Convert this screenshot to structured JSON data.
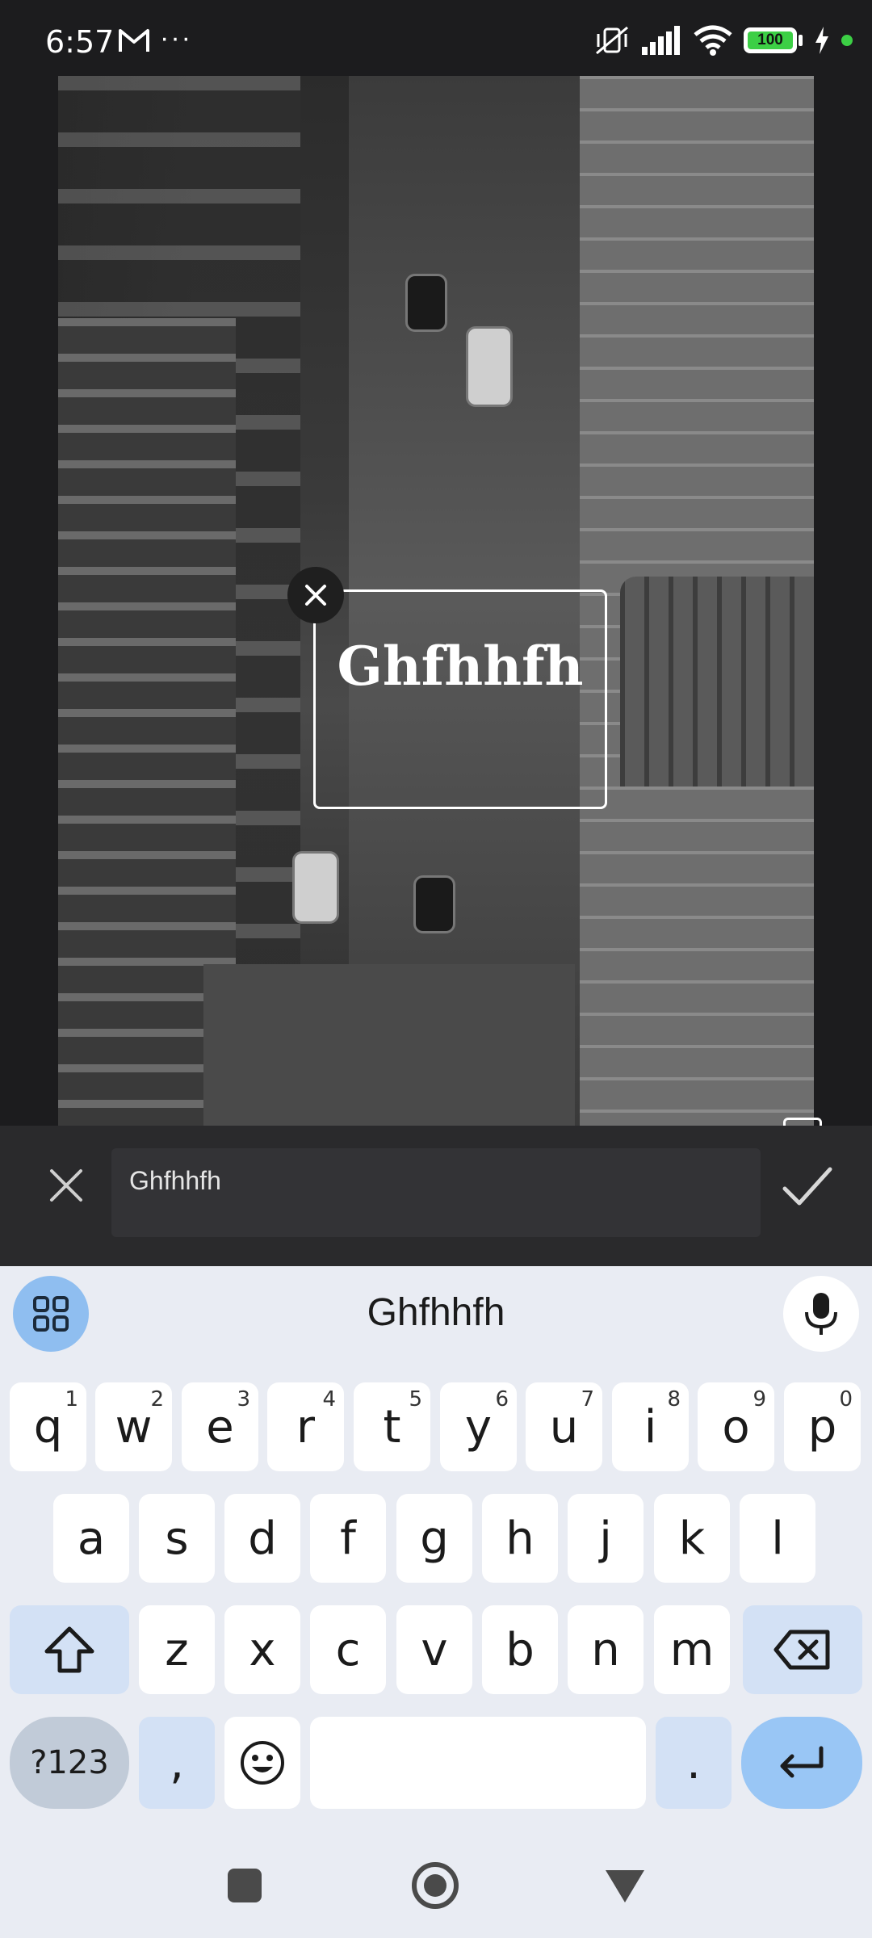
{
  "status_bar": {
    "time": "6:57",
    "extra_icons": "···",
    "battery_level": "100",
    "icons": [
      "gmail-icon",
      "more-dots-icon",
      "mute-vibrate-icon",
      "signal-icon",
      "wifi-icon",
      "battery-icon",
      "charging-icon"
    ]
  },
  "canvas": {
    "overlay_text": "Ghfhhfh"
  },
  "editor": {
    "input_value": "Ghfhhfh",
    "cancel_icon": "close-icon",
    "confirm_icon": "check-icon"
  },
  "keyboard": {
    "suggestion": "Ghfhhfh",
    "row1": [
      {
        "key": "q",
        "sup": "1"
      },
      {
        "key": "w",
        "sup": "2"
      },
      {
        "key": "e",
        "sup": "3"
      },
      {
        "key": "r",
        "sup": "4"
      },
      {
        "key": "t",
        "sup": "5"
      },
      {
        "key": "y",
        "sup": "6"
      },
      {
        "key": "u",
        "sup": "7"
      },
      {
        "key": "i",
        "sup": "8"
      },
      {
        "key": "o",
        "sup": "9"
      },
      {
        "key": "p",
        "sup": "0"
      }
    ],
    "row2": [
      "a",
      "s",
      "d",
      "f",
      "g",
      "h",
      "j",
      "k",
      "l"
    ],
    "row3": [
      "z",
      "x",
      "c",
      "v",
      "b",
      "n",
      "m"
    ],
    "num_label": "?123",
    "comma": ",",
    "period": "."
  },
  "colors": {
    "accent": "#99c6f5",
    "battery_green": "#3ccf45",
    "edit_bar_bg": "#2a2a2c"
  }
}
